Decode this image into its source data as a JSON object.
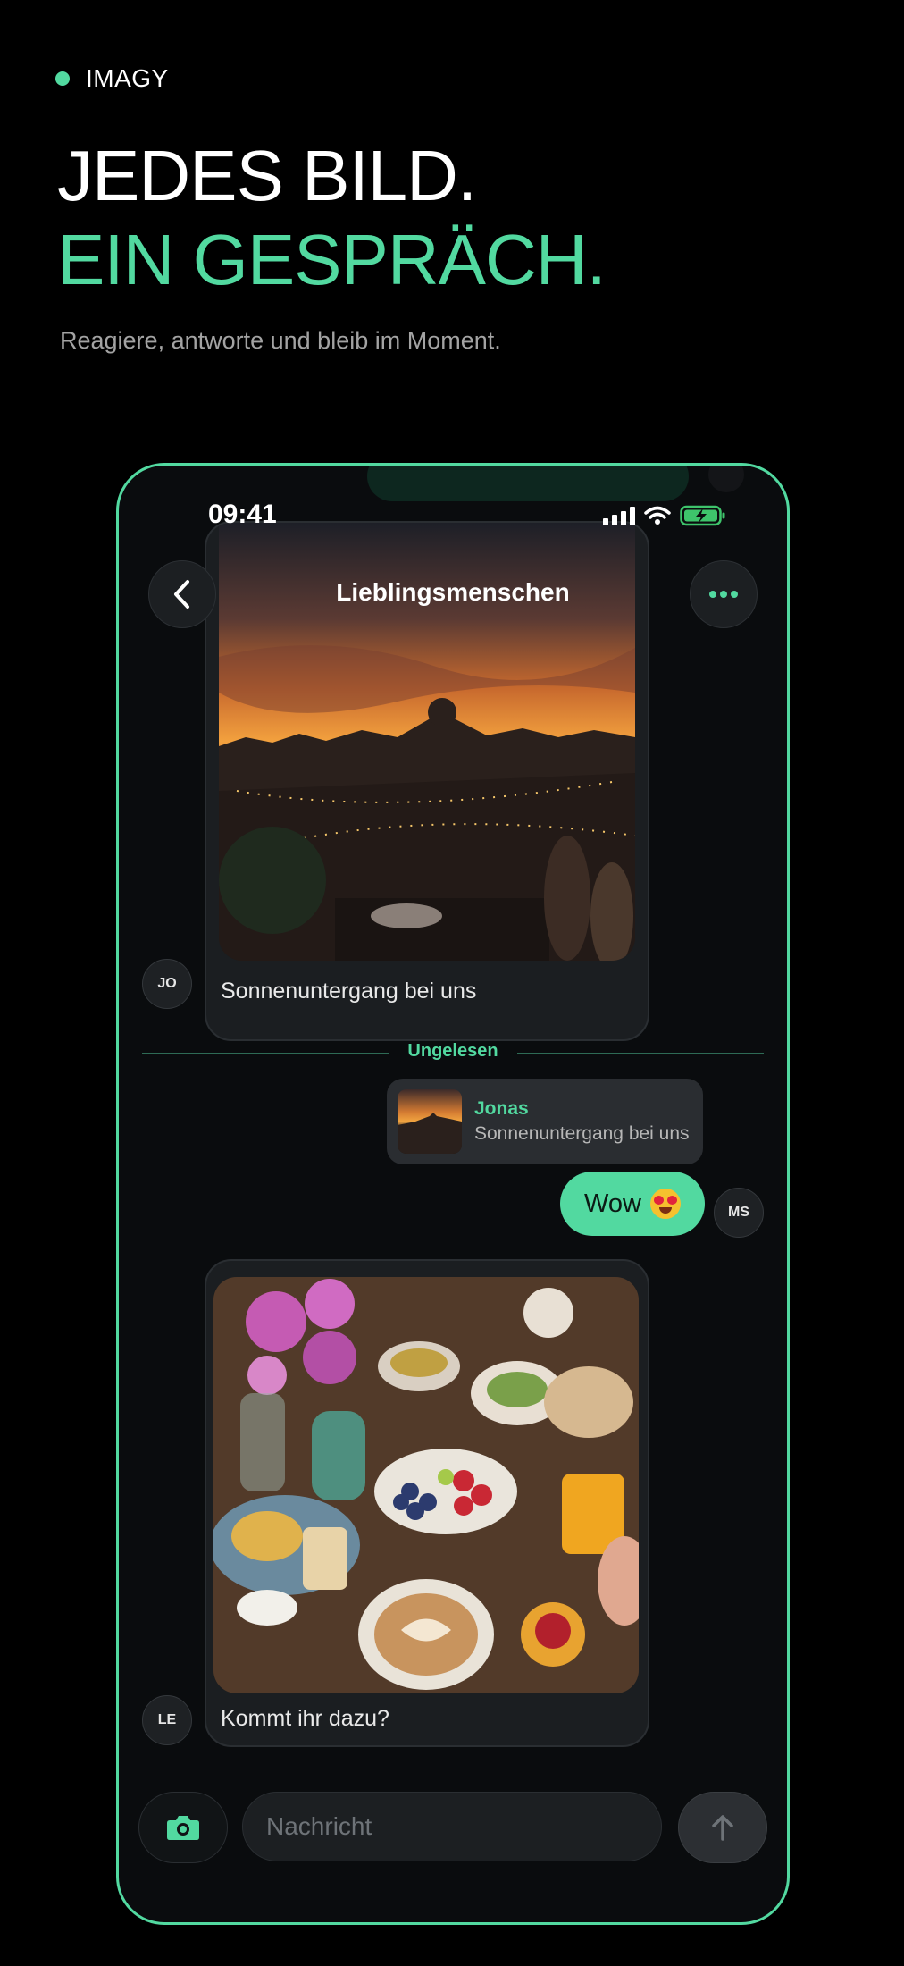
{
  "brand": {
    "name": "IMAGY"
  },
  "hero": {
    "headline_line1": "JEDES BILD.",
    "headline_line2": "EIN GESPRÄCH.",
    "subtitle": "Reagiere, antworte und bleib im Moment."
  },
  "colors": {
    "accent": "#52d9a0",
    "background": "#000000",
    "phone_bg": "#0a0c0e"
  },
  "status_bar": {
    "time": "09:41",
    "icons": [
      "signal-icon",
      "wifi-icon",
      "battery-charging-icon"
    ]
  },
  "chat": {
    "title": "Lieblingsmenschen",
    "back_icon": "chevron-left-icon",
    "more_icon": "more-dots-icon",
    "messages": [
      {
        "sender_initials": "JO",
        "type": "photo",
        "caption": "Sonnenuntergang bei uns"
      },
      {
        "sender_initials": "MS",
        "type": "text",
        "reply_to": {
          "name": "Jonas",
          "text": "Sonnenuntergang bei uns"
        },
        "text": "Wow",
        "emoji": "heart-eyes-emoji"
      },
      {
        "sender_initials": "LE",
        "type": "photo",
        "caption": "Kommt ihr dazu?"
      }
    ],
    "unread_label": "Ungelesen"
  },
  "composer": {
    "placeholder": "Nachricht",
    "camera_icon": "camera-icon",
    "send_icon": "arrow-up-icon"
  }
}
